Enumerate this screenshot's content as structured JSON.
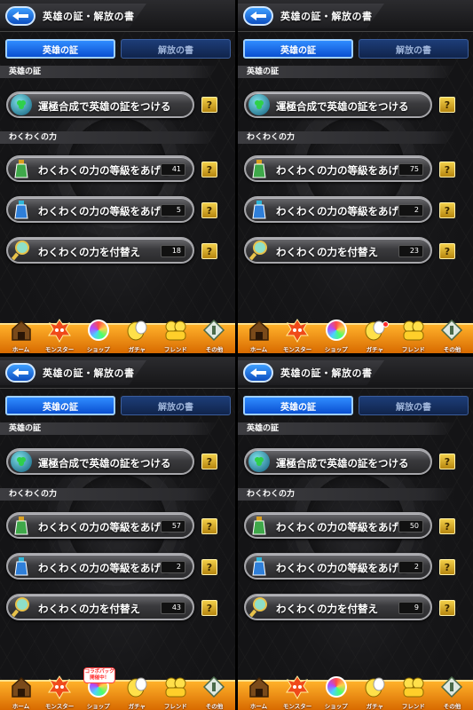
{
  "header": {
    "title": "英雄の証・解放の書"
  },
  "tabs": {
    "active": "英雄の証",
    "inactive": "解放の書"
  },
  "sections": {
    "hero": "英雄の証",
    "waku": "わくわくの力"
  },
  "buttons": {
    "attach": "運極合成で英雄の証をつける",
    "levelup": "わくわくの力の等級をあげる",
    "replace": "わくわくの力を付替え"
  },
  "help_label": "?",
  "nav": {
    "home": "ホーム",
    "monster": "モンスター",
    "shop": "ショップ",
    "gacha": "ガチャ",
    "friend": "フレンド",
    "other": "その他",
    "collab_badge_line1": "コラボパック",
    "collab_badge_line2": "開催中！"
  },
  "panels": [
    {
      "count_levelup_gold": "41",
      "count_levelup_blue": "5",
      "count_replace": "18",
      "shop_style": "orb",
      "has_dot": false,
      "has_badge": false
    },
    {
      "count_levelup_gold": "75",
      "count_levelup_blue": "2",
      "count_replace": "23",
      "shop_style": "orb",
      "has_dot": true,
      "has_badge": false
    },
    {
      "count_levelup_gold": "57",
      "count_levelup_blue": "2",
      "count_replace": "43",
      "shop_style": "orb",
      "has_dot": false,
      "has_badge": true
    },
    {
      "count_levelup_gold": "50",
      "count_levelup_blue": "2",
      "count_replace": "9",
      "shop_style": "orb",
      "has_dot": false,
      "has_badge": false
    }
  ],
  "colors": {
    "accent_blue": "#2f8cff",
    "nav_orange": "#ffb12a",
    "help_gold": "#f3d04a"
  }
}
